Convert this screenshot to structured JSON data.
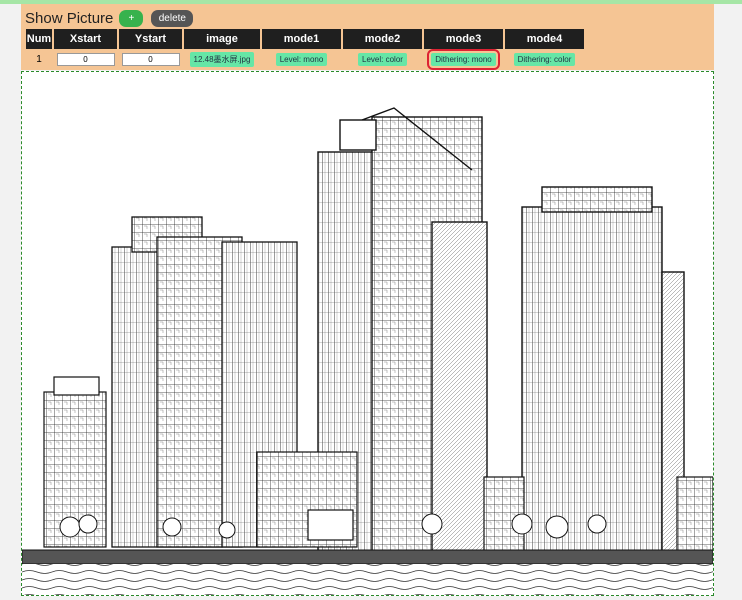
{
  "header": {
    "title": "Show Picture",
    "add_label": "+",
    "delete_label": "delete"
  },
  "table": {
    "columns": [
      "Num",
      "Xstart",
      "Ystart",
      "image",
      "mode1",
      "mode2",
      "mode3",
      "mode4"
    ],
    "rows": [
      {
        "num": "1",
        "xstart": "0",
        "ystart": "0",
        "image": "12.48墨水屏.jpg",
        "mode1": "Level: mono",
        "mode2": "Level: color",
        "mode3": "Dithering: mono",
        "mode4": "Dithering: color"
      }
    ]
  },
  "selected_mode": "mode3",
  "colors": {
    "panel": "#f5c594",
    "header_bg": "#1f1f1f",
    "chip": "#66e6a6",
    "add_button": "#37b24d",
    "delete_button": "#555555",
    "selection_outline": "#dd2233",
    "canvas_border": "#2a8a2a"
  },
  "preview": {
    "description_icon": "city-sketch-image"
  }
}
